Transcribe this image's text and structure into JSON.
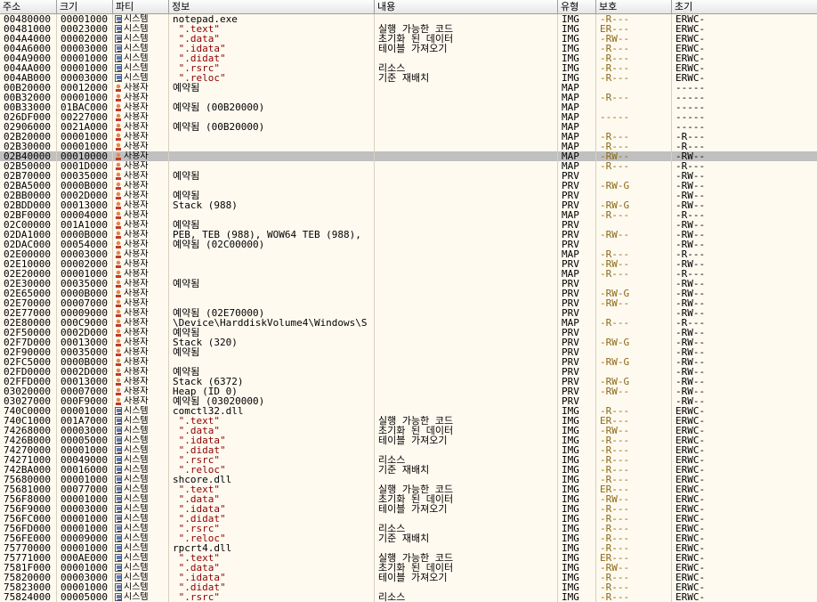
{
  "columns": {
    "addr": "주소",
    "size": "크기",
    "party": "파티",
    "info": "정보",
    "content": "내용",
    "type": "유형",
    "prot": "보호",
    "init": "초기"
  },
  "rows": [
    {
      "addr": "00480000",
      "size": "00001000",
      "party": "sys",
      "party_label": "시스템",
      "info": "notepad.exe",
      "sec": false,
      "content": "",
      "type": "IMG",
      "prot": "-R---",
      "init": "ERWC-"
    },
    {
      "addr": "00481000",
      "size": "00023000",
      "party": "sys",
      "party_label": "시스템",
      "info": " \".text\"",
      "sec": true,
      "content": "실행 가능한 코드",
      "type": "IMG",
      "prot": "ER---",
      "init": "ERWC-"
    },
    {
      "addr": "004A4000",
      "size": "00002000",
      "party": "sys",
      "party_label": "시스템",
      "info": " \".data\"",
      "sec": true,
      "content": "초기화 된 데이터",
      "type": "IMG",
      "prot": "-RW--",
      "init": "ERWC-"
    },
    {
      "addr": "004A6000",
      "size": "00003000",
      "party": "sys",
      "party_label": "시스템",
      "info": " \".idata\"",
      "sec": true,
      "content": "테이블 가져오기",
      "type": "IMG",
      "prot": "-R---",
      "init": "ERWC-"
    },
    {
      "addr": "004A9000",
      "size": "00001000",
      "party": "sys",
      "party_label": "시스템",
      "info": " \".didat\"",
      "sec": true,
      "content": "",
      "type": "IMG",
      "prot": "-R---",
      "init": "ERWC-"
    },
    {
      "addr": "004AA000",
      "size": "00001000",
      "party": "sys",
      "party_label": "시스템",
      "info": " \".rsrc\"",
      "sec": true,
      "content": "리소스",
      "type": "IMG",
      "prot": "-R---",
      "init": "ERWC-"
    },
    {
      "addr": "004AB000",
      "size": "00003000",
      "party": "sys",
      "party_label": "시스템",
      "info": " \".reloc\"",
      "sec": true,
      "content": "기준 재배치",
      "type": "IMG",
      "prot": "-R---",
      "init": "ERWC-"
    },
    {
      "addr": "00B20000",
      "size": "00012000",
      "party": "user",
      "party_label": "사용자",
      "info": "예약됨",
      "sec": false,
      "content": "",
      "type": "MAP",
      "prot": "",
      "init": "-----"
    },
    {
      "addr": "00B32000",
      "size": "00001000",
      "party": "user",
      "party_label": "사용자",
      "info": "",
      "sec": false,
      "content": "",
      "type": "MAP",
      "prot": "-R---",
      "init": "-----"
    },
    {
      "addr": "00B33000",
      "size": "01BAC000",
      "party": "user",
      "party_label": "사용자",
      "info": "예약됨 (00B20000)",
      "sec": false,
      "content": "",
      "type": "MAP",
      "prot": "",
      "init": "-----"
    },
    {
      "addr": "026DF000",
      "size": "00227000",
      "party": "user",
      "party_label": "사용자",
      "info": "",
      "sec": false,
      "content": "",
      "type": "MAP",
      "prot": "-----",
      "init": "-----"
    },
    {
      "addr": "02906000",
      "size": "0021A000",
      "party": "user",
      "party_label": "사용자",
      "info": "예약됨 (00B20000)",
      "sec": false,
      "content": "",
      "type": "MAP",
      "prot": "",
      "init": "-----"
    },
    {
      "addr": "02B20000",
      "size": "00001000",
      "party": "user",
      "party_label": "사용자",
      "info": "",
      "sec": false,
      "content": "",
      "type": "MAP",
      "prot": "-R---",
      "init": "-R---"
    },
    {
      "addr": "02B30000",
      "size": "00001000",
      "party": "user",
      "party_label": "사용자",
      "info": "",
      "sec": false,
      "content": "",
      "type": "MAP",
      "prot": "-R---",
      "init": "-R---"
    },
    {
      "addr": "02B40000",
      "size": "00010000",
      "party": "user",
      "party_label": "사용자",
      "info": "",
      "sec": false,
      "content": "",
      "type": "MAP",
      "prot": "-RW--",
      "init": "-RW--",
      "selected": true
    },
    {
      "addr": "02B50000",
      "size": "0001D000",
      "party": "user",
      "party_label": "사용자",
      "info": "",
      "sec": false,
      "content": "",
      "type": "MAP",
      "prot": "-R---",
      "init": "-R---"
    },
    {
      "addr": "02B70000",
      "size": "00035000",
      "party": "user",
      "party_label": "사용자",
      "info": "예약됨",
      "sec": false,
      "content": "",
      "type": "PRV",
      "prot": "",
      "init": "-RW--"
    },
    {
      "addr": "02BA5000",
      "size": "0000B000",
      "party": "user",
      "party_label": "사용자",
      "info": "",
      "sec": false,
      "content": "",
      "type": "PRV",
      "prot": "-RW-G",
      "init": "-RW--"
    },
    {
      "addr": "02BB0000",
      "size": "0002D000",
      "party": "user",
      "party_label": "사용자",
      "info": "예약됨",
      "sec": false,
      "content": "",
      "type": "PRV",
      "prot": "",
      "init": "-RW--"
    },
    {
      "addr": "02BDD000",
      "size": "00013000",
      "party": "user",
      "party_label": "사용자",
      "info": "Stack (988)",
      "sec": false,
      "content": "",
      "type": "PRV",
      "prot": "-RW-G",
      "init": "-RW--"
    },
    {
      "addr": "02BF0000",
      "size": "00004000",
      "party": "user",
      "party_label": "사용자",
      "info": "",
      "sec": false,
      "content": "",
      "type": "MAP",
      "prot": "-R---",
      "init": "-R---"
    },
    {
      "addr": "02C00000",
      "size": "001A1000",
      "party": "user",
      "party_label": "사용자",
      "info": "예약됨",
      "sec": false,
      "content": "",
      "type": "PRV",
      "prot": "",
      "init": "-RW--"
    },
    {
      "addr": "02DA1000",
      "size": "0000B000",
      "party": "user",
      "party_label": "사용자",
      "info": "PEB, TEB (988), WOW64 TEB (988),",
      "sec": false,
      "content": "",
      "type": "PRV",
      "prot": "-RW--",
      "init": "-RW--"
    },
    {
      "addr": "02DAC000",
      "size": "00054000",
      "party": "user",
      "party_label": "사용자",
      "info": "예약됨 (02C00000)",
      "sec": false,
      "content": "",
      "type": "PRV",
      "prot": "",
      "init": "-RW--"
    },
    {
      "addr": "02E00000",
      "size": "00003000",
      "party": "user",
      "party_label": "사용자",
      "info": "",
      "sec": false,
      "content": "",
      "type": "MAP",
      "prot": "-R---",
      "init": "-R---"
    },
    {
      "addr": "02E10000",
      "size": "00002000",
      "party": "user",
      "party_label": "사용자",
      "info": "",
      "sec": false,
      "content": "",
      "type": "PRV",
      "prot": "-RW--",
      "init": "-RW--"
    },
    {
      "addr": "02E20000",
      "size": "00001000",
      "party": "user",
      "party_label": "사용자",
      "info": "",
      "sec": false,
      "content": "",
      "type": "MAP",
      "prot": "-R---",
      "init": "-R---"
    },
    {
      "addr": "02E30000",
      "size": "00035000",
      "party": "user",
      "party_label": "사용자",
      "info": "예약됨",
      "sec": false,
      "content": "",
      "type": "PRV",
      "prot": "",
      "init": "-RW--"
    },
    {
      "addr": "02E65000",
      "size": "0000B000",
      "party": "user",
      "party_label": "사용자",
      "info": "",
      "sec": false,
      "content": "",
      "type": "PRV",
      "prot": "-RW-G",
      "init": "-RW--"
    },
    {
      "addr": "02E70000",
      "size": "00007000",
      "party": "user",
      "party_label": "사용자",
      "info": "",
      "sec": false,
      "content": "",
      "type": "PRV",
      "prot": "-RW--",
      "init": "-RW--"
    },
    {
      "addr": "02E77000",
      "size": "00009000",
      "party": "user",
      "party_label": "사용자",
      "info": "예약됨 (02E70000)",
      "sec": false,
      "content": "",
      "type": "PRV",
      "prot": "",
      "init": "-RW--"
    },
    {
      "addr": "02E80000",
      "size": "000C9000",
      "party": "user",
      "party_label": "사용자",
      "info": "\\Device\\HarddiskVolume4\\Windows\\S",
      "sec": false,
      "content": "",
      "type": "MAP",
      "prot": "-R---",
      "init": "-R---"
    },
    {
      "addr": "02F50000",
      "size": "0002D000",
      "party": "user",
      "party_label": "사용자",
      "info": "예약됨",
      "sec": false,
      "content": "",
      "type": "PRV",
      "prot": "",
      "init": "-RW--"
    },
    {
      "addr": "02F7D000",
      "size": "00013000",
      "party": "user",
      "party_label": "사용자",
      "info": "Stack (320)",
      "sec": false,
      "content": "",
      "type": "PRV",
      "prot": "-RW-G",
      "init": "-RW--"
    },
    {
      "addr": "02F90000",
      "size": "00035000",
      "party": "user",
      "party_label": "사용자",
      "info": "예약됨",
      "sec": false,
      "content": "",
      "type": "PRV",
      "prot": "",
      "init": "-RW--"
    },
    {
      "addr": "02FC5000",
      "size": "0000B000",
      "party": "user",
      "party_label": "사용자",
      "info": "",
      "sec": false,
      "content": "",
      "type": "PRV",
      "prot": "-RW-G",
      "init": "-RW--"
    },
    {
      "addr": "02FD0000",
      "size": "0002D000",
      "party": "user",
      "party_label": "사용자",
      "info": "예약됨",
      "sec": false,
      "content": "",
      "type": "PRV",
      "prot": "",
      "init": "-RW--"
    },
    {
      "addr": "02FFD000",
      "size": "00013000",
      "party": "user",
      "party_label": "사용자",
      "info": "Stack (6372)",
      "sec": false,
      "content": "",
      "type": "PRV",
      "prot": "-RW-G",
      "init": "-RW--"
    },
    {
      "addr": "03020000",
      "size": "00007000",
      "party": "user",
      "party_label": "사용자",
      "info": "Heap (ID 0)",
      "sec": false,
      "content": "",
      "type": "PRV",
      "prot": "-RW--",
      "init": "-RW--"
    },
    {
      "addr": "03027000",
      "size": "000F9000",
      "party": "user",
      "party_label": "사용자",
      "info": "예약됨 (03020000)",
      "sec": false,
      "content": "",
      "type": "PRV",
      "prot": "",
      "init": "-RW--"
    },
    {
      "addr": "740C0000",
      "size": "00001000",
      "party": "sys",
      "party_label": "시스템",
      "info": "comctl32.dll",
      "sec": false,
      "content": "",
      "type": "IMG",
      "prot": "-R---",
      "init": "ERWC-"
    },
    {
      "addr": "740C1000",
      "size": "001A7000",
      "party": "sys",
      "party_label": "시스템",
      "info": " \".text\"",
      "sec": true,
      "content": "실행 가능한 코드",
      "type": "IMG",
      "prot": "ER---",
      "init": "ERWC-"
    },
    {
      "addr": "74268000",
      "size": "00003000",
      "party": "sys",
      "party_label": "시스템",
      "info": " \".data\"",
      "sec": true,
      "content": "초기화 된 데이터",
      "type": "IMG",
      "prot": "-RW--",
      "init": "ERWC-"
    },
    {
      "addr": "7426B000",
      "size": "00005000",
      "party": "sys",
      "party_label": "시스템",
      "info": " \".idata\"",
      "sec": true,
      "content": "테이블 가져오기",
      "type": "IMG",
      "prot": "-R---",
      "init": "ERWC-"
    },
    {
      "addr": "74270000",
      "size": "00001000",
      "party": "sys",
      "party_label": "시스템",
      "info": " \".didat\"",
      "sec": true,
      "content": "",
      "type": "IMG",
      "prot": "-R---",
      "init": "ERWC-"
    },
    {
      "addr": "74271000",
      "size": "00049000",
      "party": "sys",
      "party_label": "시스템",
      "info": " \".rsrc\"",
      "sec": true,
      "content": "리소스",
      "type": "IMG",
      "prot": "-R---",
      "init": "ERWC-"
    },
    {
      "addr": "742BA000",
      "size": "00016000",
      "party": "sys",
      "party_label": "시스템",
      "info": " \".reloc\"",
      "sec": true,
      "content": "기준 재배치",
      "type": "IMG",
      "prot": "-R---",
      "init": "ERWC-"
    },
    {
      "addr": "75680000",
      "size": "00001000",
      "party": "sys",
      "party_label": "시스템",
      "info": "shcore.dll",
      "sec": false,
      "content": "",
      "type": "IMG",
      "prot": "-R---",
      "init": "ERWC-"
    },
    {
      "addr": "75681000",
      "size": "00077000",
      "party": "sys",
      "party_label": "시스템",
      "info": " \".text\"",
      "sec": true,
      "content": "실행 가능한 코드",
      "type": "IMG",
      "prot": "ER---",
      "init": "ERWC-"
    },
    {
      "addr": "756F8000",
      "size": "00001000",
      "party": "sys",
      "party_label": "시스템",
      "info": " \".data\"",
      "sec": true,
      "content": "초기화 된 데이터",
      "type": "IMG",
      "prot": "-RW--",
      "init": "ERWC-"
    },
    {
      "addr": "756F9000",
      "size": "00003000",
      "party": "sys",
      "party_label": "시스템",
      "info": " \".idata\"",
      "sec": true,
      "content": "테이블 가져오기",
      "type": "IMG",
      "prot": "-R---",
      "init": "ERWC-"
    },
    {
      "addr": "756FC000",
      "size": "00001000",
      "party": "sys",
      "party_label": "시스템",
      "info": " \".didat\"",
      "sec": true,
      "content": "",
      "type": "IMG",
      "prot": "-R---",
      "init": "ERWC-"
    },
    {
      "addr": "756FD000",
      "size": "00001000",
      "party": "sys",
      "party_label": "시스템",
      "info": " \".rsrc\"",
      "sec": true,
      "content": "리소스",
      "type": "IMG",
      "prot": "-R---",
      "init": "ERWC-"
    },
    {
      "addr": "756FE000",
      "size": "00009000",
      "party": "sys",
      "party_label": "시스템",
      "info": " \".reloc\"",
      "sec": true,
      "content": "기준 재배치",
      "type": "IMG",
      "prot": "-R---",
      "init": "ERWC-"
    },
    {
      "addr": "75770000",
      "size": "00001000",
      "party": "sys",
      "party_label": "시스템",
      "info": "rpcrt4.dll",
      "sec": false,
      "content": "",
      "type": "IMG",
      "prot": "-R---",
      "init": "ERWC-"
    },
    {
      "addr": "75771000",
      "size": "000AE000",
      "party": "sys",
      "party_label": "시스템",
      "info": " \".text\"",
      "sec": true,
      "content": "실행 가능한 코드",
      "type": "IMG",
      "prot": "ER---",
      "init": "ERWC-"
    },
    {
      "addr": "7581F000",
      "size": "00001000",
      "party": "sys",
      "party_label": "시스템",
      "info": " \".data\"",
      "sec": true,
      "content": "초기화 된 데이터",
      "type": "IMG",
      "prot": "-RW--",
      "init": "ERWC-"
    },
    {
      "addr": "75820000",
      "size": "00003000",
      "party": "sys",
      "party_label": "시스템",
      "info": " \".idata\"",
      "sec": true,
      "content": "테이블 가져오기",
      "type": "IMG",
      "prot": "-R---",
      "init": "ERWC-"
    },
    {
      "addr": "75823000",
      "size": "00001000",
      "party": "sys",
      "party_label": "시스템",
      "info": " \".didat\"",
      "sec": true,
      "content": "",
      "type": "IMG",
      "prot": "-R---",
      "init": "ERWC-"
    },
    {
      "addr": "75824000",
      "size": "00005000",
      "party": "sys",
      "party_label": "시스템",
      "info": " \".rsrc\"",
      "sec": true,
      "content": "리소스",
      "type": "IMG",
      "prot": "-R---",
      "init": "ERWC-"
    }
  ],
  "colors": {
    "background": "#fffaf0",
    "selected_row": "#c0c0c0",
    "section_text": "#8b0000",
    "protection_text": "#8b6914"
  }
}
